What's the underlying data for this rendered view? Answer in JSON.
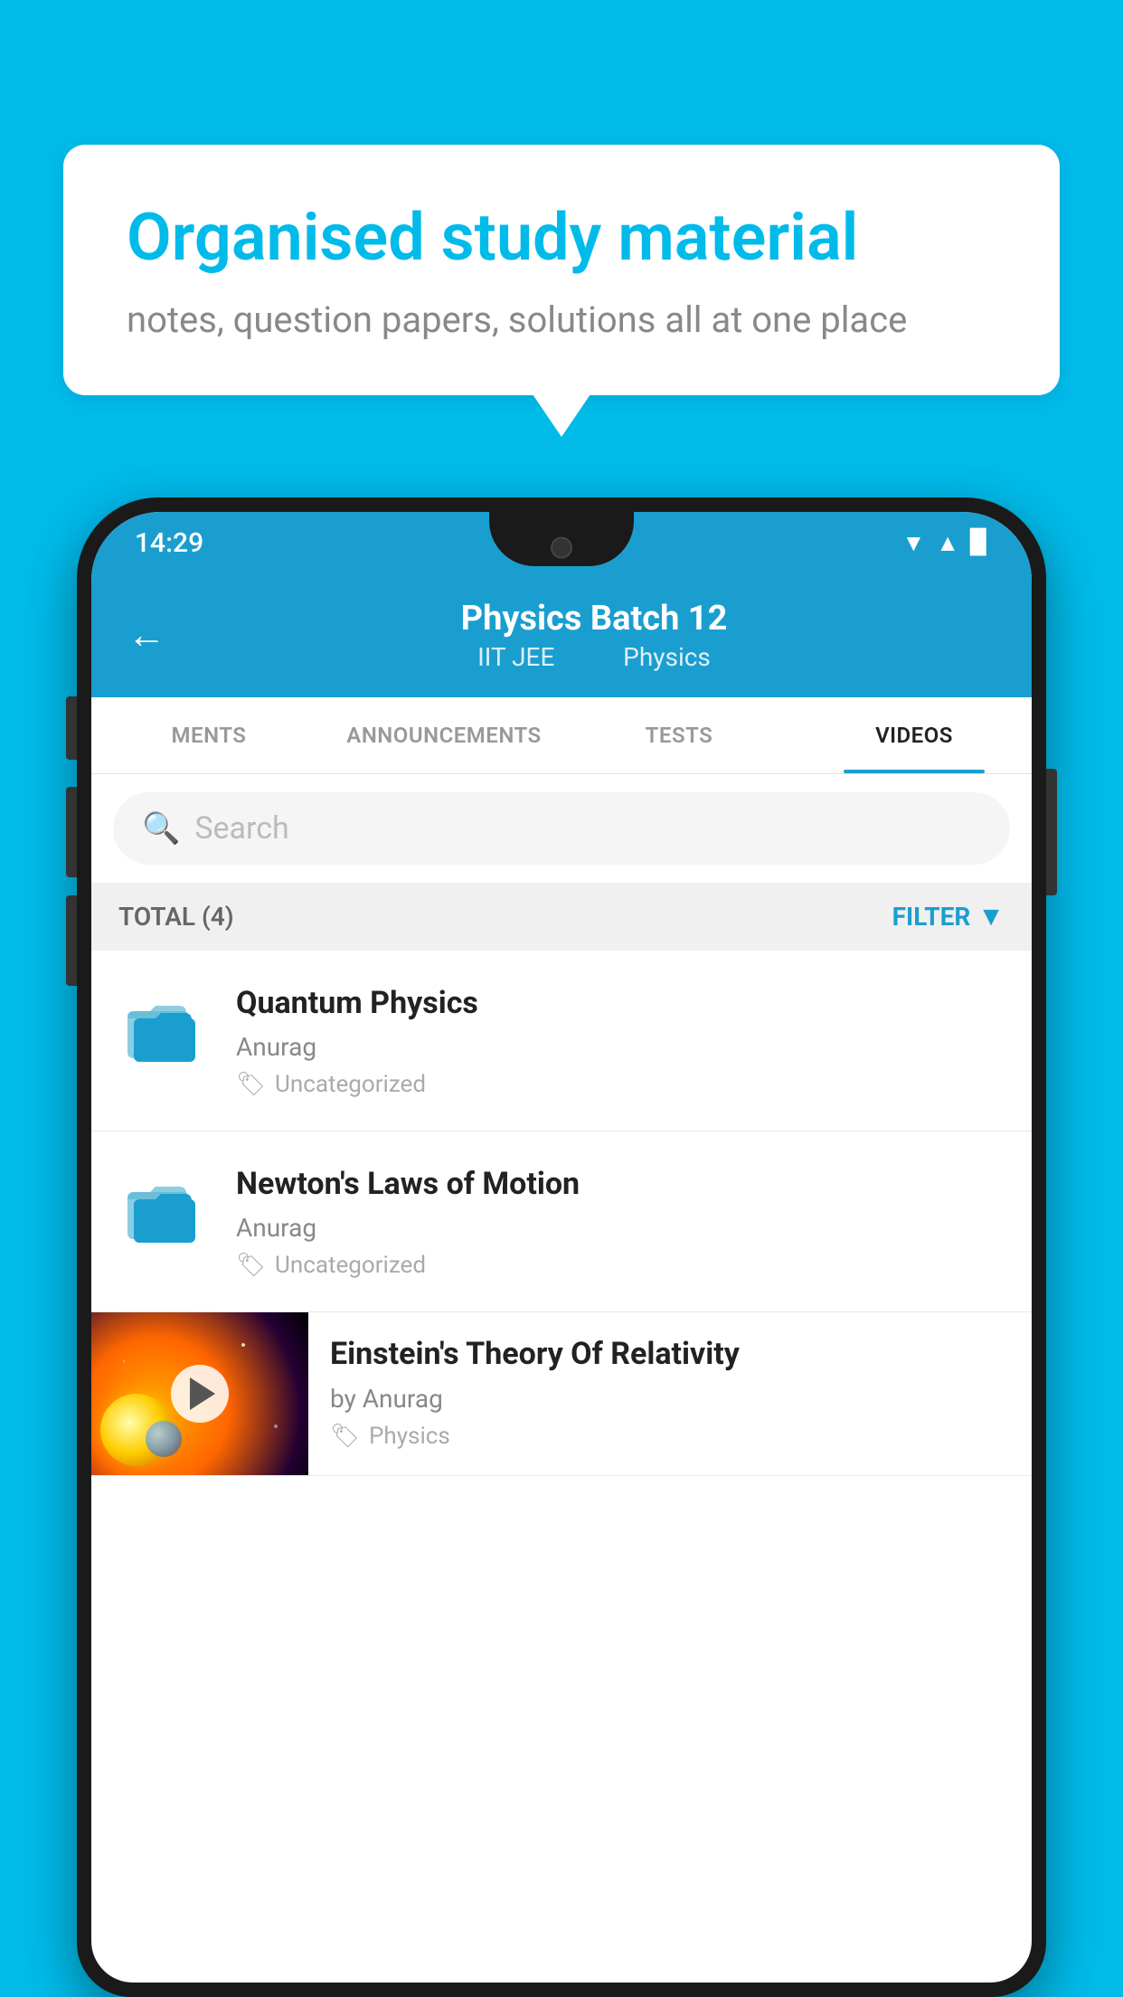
{
  "background": {
    "color": "#00BBEA"
  },
  "speech_bubble": {
    "title": "Organised study material",
    "subtitle": "notes, question papers, solutions all at one place"
  },
  "status_bar": {
    "time": "14:29",
    "icons": [
      "wifi",
      "signal",
      "battery"
    ]
  },
  "app_header": {
    "back_label": "←",
    "title": "Physics Batch 12",
    "subtitle_part1": "IIT JEE",
    "subtitle_part2": "Physics"
  },
  "tabs": [
    {
      "label": "MENTS",
      "active": false
    },
    {
      "label": "ANNOUNCEMENTS",
      "active": false
    },
    {
      "label": "TESTS",
      "active": false
    },
    {
      "label": "VIDEOS",
      "active": true
    }
  ],
  "search": {
    "placeholder": "Search"
  },
  "filter_bar": {
    "total_label": "TOTAL (4)",
    "filter_label": "FILTER"
  },
  "videos": [
    {
      "id": "1",
      "title": "Quantum Physics",
      "author": "Anurag",
      "tag": "Uncategorized",
      "type": "folder"
    },
    {
      "id": "2",
      "title": "Newton's Laws of Motion",
      "author": "Anurag",
      "tag": "Uncategorized",
      "type": "folder"
    },
    {
      "id": "3",
      "title": "Einstein's Theory Of Relativity",
      "author": "by Anurag",
      "tag": "Physics",
      "type": "video"
    }
  ]
}
